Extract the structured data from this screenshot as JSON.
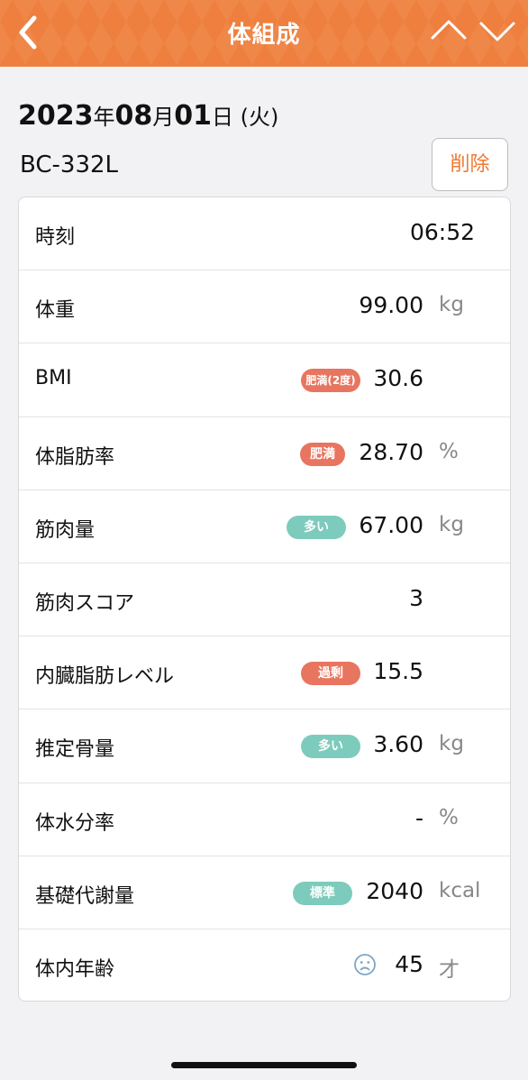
{
  "header": {
    "title": "体組成",
    "back_icon": "chevron-left-icon",
    "prev_icon": "chevron-up-icon",
    "next_icon": "chevron-down-icon",
    "background_color": "#ee7f3e"
  },
  "date": {
    "year": "2023",
    "year_unit": "年",
    "month": "08",
    "month_unit": "月",
    "day": "01",
    "day_unit": "日",
    "weekday": " (火)"
  },
  "device": {
    "model": "BC-332L",
    "delete_label": "削除"
  },
  "rows": [
    {
      "label": "時刻",
      "value": "06:52"
    },
    {
      "label": "体重",
      "value": "99.00",
      "unit": "kg"
    },
    {
      "label": "BMI",
      "badge": "肥満(2度)",
      "value": "30.6"
    },
    {
      "label": "体脂肪率",
      "badge": "肥満",
      "value": "28.70",
      "unit": "%"
    },
    {
      "label": "筋肉量",
      "badge": "多い",
      "value": "67.00",
      "unit": "kg"
    },
    {
      "label": "筋肉スコア",
      "value": "3"
    },
    {
      "label": "内臓脂肪レベル",
      "badge": "過剰",
      "value": "15.5"
    },
    {
      "label": "推定骨量",
      "badge": "多い",
      "value": "3.60",
      "unit": "kg"
    },
    {
      "label": "体水分率",
      "value": "-",
      "unit": "%"
    },
    {
      "label": "基礎代謝量",
      "badge": "標準",
      "value": "2040",
      "unit": "kcal"
    },
    {
      "label": "体内年齢",
      "icon": "sad-face-icon",
      "value": "45",
      "unit": "才"
    }
  ],
  "colors": {
    "accent": "#ee7f3e",
    "badge_red": "#e8755f",
    "badge_teal": "#7dcbbc"
  }
}
